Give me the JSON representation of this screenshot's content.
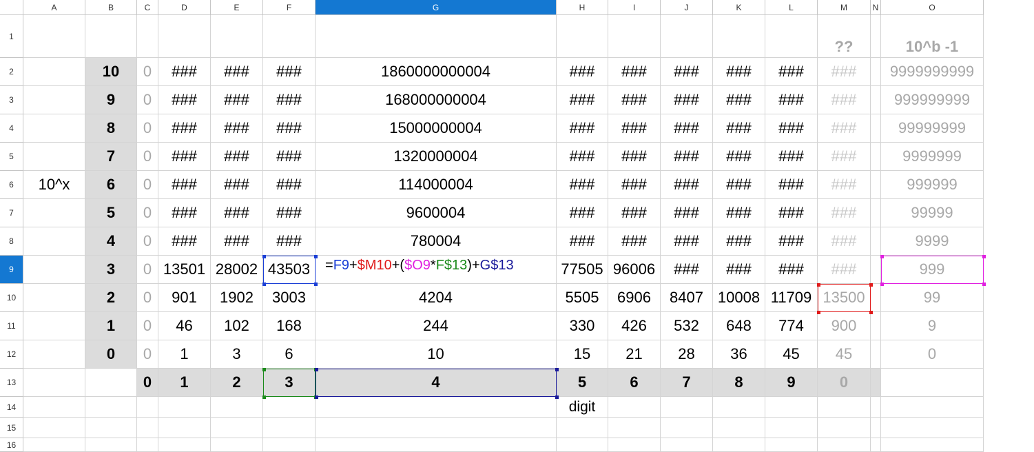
{
  "columns": [
    "A",
    "B",
    "C",
    "D",
    "E",
    "F",
    "G",
    "H",
    "I",
    "J",
    "K",
    "L",
    "M",
    "N",
    "O"
  ],
  "rows": [
    "1",
    "2",
    "3",
    "4",
    "5",
    "6",
    "7",
    "8",
    "9",
    "10",
    "11",
    "12",
    "13",
    "14",
    "15",
    "16"
  ],
  "active": {
    "column": "G",
    "row": "9"
  },
  "header_cells": {
    "M1": "??",
    "O1": "10^b -1",
    "A6": "10^x",
    "H14": "digit"
  },
  "exponent_labels": [
    "10",
    "9",
    "8",
    "7",
    "6",
    "5",
    "4",
    "3",
    "2",
    "1",
    "0"
  ],
  "digit_labels": [
    "0",
    "1",
    "2",
    "3",
    "4",
    "5",
    "6",
    "7",
    "8",
    "9",
    "0"
  ],
  "grid": [
    [
      "0",
      "###",
      "###",
      "###",
      "1860000000004",
      "###",
      "###",
      "###",
      "###",
      "###",
      "###",
      "9999999999"
    ],
    [
      "0",
      "###",
      "###",
      "###",
      "168000000004",
      "###",
      "###",
      "###",
      "###",
      "###",
      "###",
      "999999999"
    ],
    [
      "0",
      "###",
      "###",
      "###",
      "15000000004",
      "###",
      "###",
      "###",
      "###",
      "###",
      "###",
      "99999999"
    ],
    [
      "0",
      "###",
      "###",
      "###",
      "1320000004",
      "###",
      "###",
      "###",
      "###",
      "###",
      "###",
      "9999999"
    ],
    [
      "0",
      "###",
      "###",
      "###",
      "114000004",
      "###",
      "###",
      "###",
      "###",
      "###",
      "###",
      "999999"
    ],
    [
      "0",
      "###",
      "###",
      "###",
      "9600004",
      "###",
      "###",
      "###",
      "###",
      "###",
      "###",
      "99999"
    ],
    [
      "0",
      "###",
      "###",
      "###",
      "780004",
      "###",
      "###",
      "###",
      "###",
      "###",
      "###",
      "9999"
    ],
    [
      "0",
      "13501",
      "28002",
      "43503",
      "",
      "77505",
      "96006",
      "###",
      "###",
      "###",
      "###",
      "999"
    ],
    [
      "0",
      "901",
      "1902",
      "3003",
      "4204",
      "5505",
      "6906",
      "8407",
      "10008",
      "11709",
      "13500",
      "99"
    ],
    [
      "0",
      "46",
      "102",
      "168",
      "244",
      "330",
      "426",
      "532",
      "648",
      "774",
      "900",
      "9"
    ],
    [
      "0",
      "1",
      "3",
      "6",
      "10",
      "15",
      "21",
      "28",
      "36",
      "45",
      "45",
      "0"
    ]
  ],
  "formula_parts": [
    {
      "text": "=",
      "color": "#000000"
    },
    {
      "text": "F9",
      "color": "#1b3fd6"
    },
    {
      "text": "+",
      "color": "#000000"
    },
    {
      "text": "$M10",
      "color": "#e01b1b"
    },
    {
      "text": "+(",
      "color": "#000000"
    },
    {
      "text": "$O9",
      "color": "#e020e0"
    },
    {
      "text": "*",
      "color": "#000000"
    },
    {
      "text": "F$13",
      "color": "#1a8a1a"
    },
    {
      "text": ")+",
      "color": "#000000"
    },
    {
      "text": "G$13",
      "color": "#1a1a9a"
    }
  ],
  "colors": {
    "shade": "#dcdcdc",
    "active_header": "#1478d2",
    "ref_blue": "#1b3fd6",
    "ref_red": "#e01b1b",
    "ref_magenta": "#e020e0",
    "ref_green": "#1a8a1a",
    "ref_navy": "#1a1a9a",
    "muted_text": "#a8a8a8"
  }
}
